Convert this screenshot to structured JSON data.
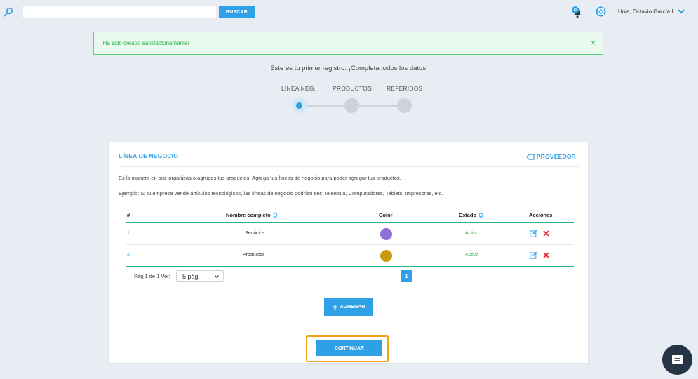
{
  "topbar": {
    "search_placeholder": "",
    "search_button": "BUSCAR",
    "notifications_count": "0",
    "user_greeting": "Hola, Octavio García L"
  },
  "alert": {
    "message": "¡Ha sido creado satisfactoriamente!",
    "close": "×"
  },
  "intro_text": "Este es tu primer registro. ¡Completa todos los datos!",
  "steps": [
    {
      "label": "LÍNEA NEG.",
      "active": true
    },
    {
      "label": "PRODUCTOS",
      "active": false
    },
    {
      "label": "REFERIDOS",
      "active": false
    }
  ],
  "card": {
    "title": "LÍNEA DE NEGOCIO",
    "provider_link": "PROVEEDOR",
    "description": "Es la manera en que organizas o agrupas tus productos. Agrega tus líneas de negocio para poder agregar tus productos.",
    "example": "Ejemplo: Si tu empresa vende artículos tecnológicos, las líneas de negocio podrían ser: Telefonía, Computadores, Tablets, Impresoras, etc."
  },
  "table": {
    "headers": {
      "num": "#",
      "name": "Nombre completo",
      "color": "Color",
      "status": "Estado",
      "actions": "Acciones"
    },
    "rows": [
      {
        "num": "1",
        "name": "Servicios",
        "color": "#8f6fd9",
        "status": "Activo"
      },
      {
        "num": "2",
        "name": "Productos",
        "color": "#c99a12",
        "status": "Activo"
      }
    ]
  },
  "pagination": {
    "text": "Pág 1 de 1 Ver:",
    "per_page": "5 pág.",
    "current_page": "1"
  },
  "buttons": {
    "add": "AGREGAR",
    "continue": "CONTINUAR"
  },
  "colors": {
    "accent": "#2f9fe6",
    "success": "#27b24e",
    "highlight": "#f2a11e"
  }
}
